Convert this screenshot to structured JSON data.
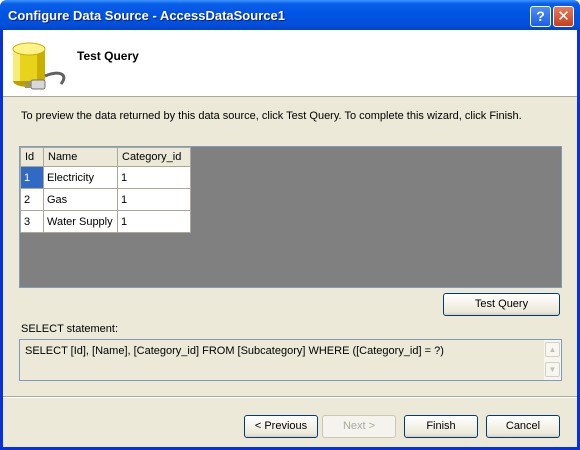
{
  "window": {
    "title": "Configure Data Source - AccessDataSource1",
    "help_label": "?",
    "close_label": "✕"
  },
  "header": {
    "title": "Test Query",
    "icon": "database-plug-icon"
  },
  "instruction": "To preview the data returned by this data source, click Test Query. To complete this wizard, click Finish.",
  "results": {
    "columns": [
      "Id",
      "Name",
      "Category_id"
    ],
    "rows": [
      [
        "1",
        "Electricity",
        "1"
      ],
      [
        "2",
        "Gas",
        "1"
      ],
      [
        "3",
        "Water Supply",
        "1"
      ]
    ],
    "selected_row": 0
  },
  "test_query_button": "Test Query",
  "select_statement": {
    "label": "SELECT statement:",
    "text": "SELECT [Id], [Name], [Category_id] FROM [Subcategory] WHERE ([Category_id] = ?)"
  },
  "footer": {
    "previous_label": "< Previous",
    "next_label": "Next >",
    "finish_label": "Finish",
    "cancel_label": "Cancel"
  },
  "colors": {
    "title_bar": "#0054e3",
    "dialog_bg": "#ece9d8",
    "selection": "#316ac5",
    "grid_background": "#808080"
  }
}
